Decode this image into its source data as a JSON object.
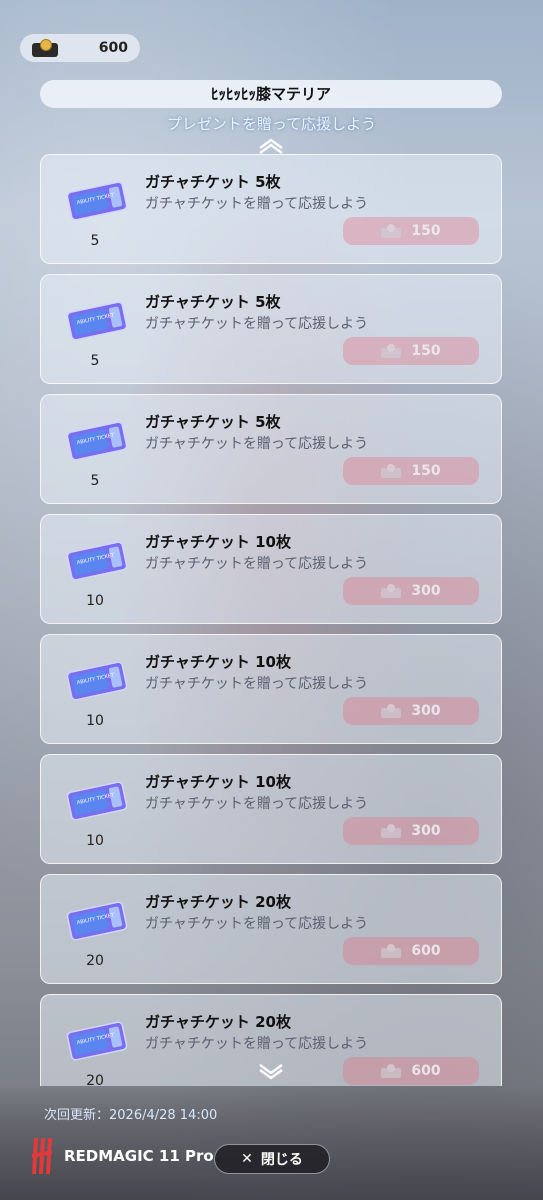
{
  "currency": {
    "value": "600",
    "icon": "currency-box-icon"
  },
  "header": {
    "title": "ﾋｯﾋｯﾋｯ膝マテリア",
    "subtitle": "プレゼントを贈って応援しよう"
  },
  "items": [
    {
      "title": "ガチャチケット 5枚",
      "desc": "ガチャチケットを贈って応援しよう",
      "qty": "5",
      "price": "150"
    },
    {
      "title": "ガチャチケット 5枚",
      "desc": "ガチャチケットを贈って応援しよう",
      "qty": "5",
      "price": "150"
    },
    {
      "title": "ガチャチケット 5枚",
      "desc": "ガチャチケットを贈って応援しよう",
      "qty": "5",
      "price": "150"
    },
    {
      "title": "ガチャチケット 10枚",
      "desc": "ガチャチケットを贈って応援しよう",
      "qty": "10",
      "price": "300"
    },
    {
      "title": "ガチャチケット 10枚",
      "desc": "ガチャチケットを贈って応援しよう",
      "qty": "10",
      "price": "300"
    },
    {
      "title": "ガチャチケット 10枚",
      "desc": "ガチャチケットを贈って応援しよう",
      "qty": "10",
      "price": "300"
    },
    {
      "title": "ガチャチケット 20枚",
      "desc": "ガチャチケットを贈って応援しよう",
      "qty": "20",
      "price": "600"
    },
    {
      "title": "ガチャチケット 20枚",
      "desc": "ガチャチケットを贈って応援しよう",
      "qty": "20",
      "price": "600"
    }
  ],
  "ticket_art_label": "ABILITY TICKET",
  "footer": {
    "next_update": "次回更新：2026/4/28 14:00",
    "close_label": "閉じる",
    "watermark": "REDMAGIC 11 Pro"
  },
  "colors": {
    "accent_button": "#e66e7d",
    "title_bar": "#eef2fa",
    "close_bg": "#232328"
  }
}
